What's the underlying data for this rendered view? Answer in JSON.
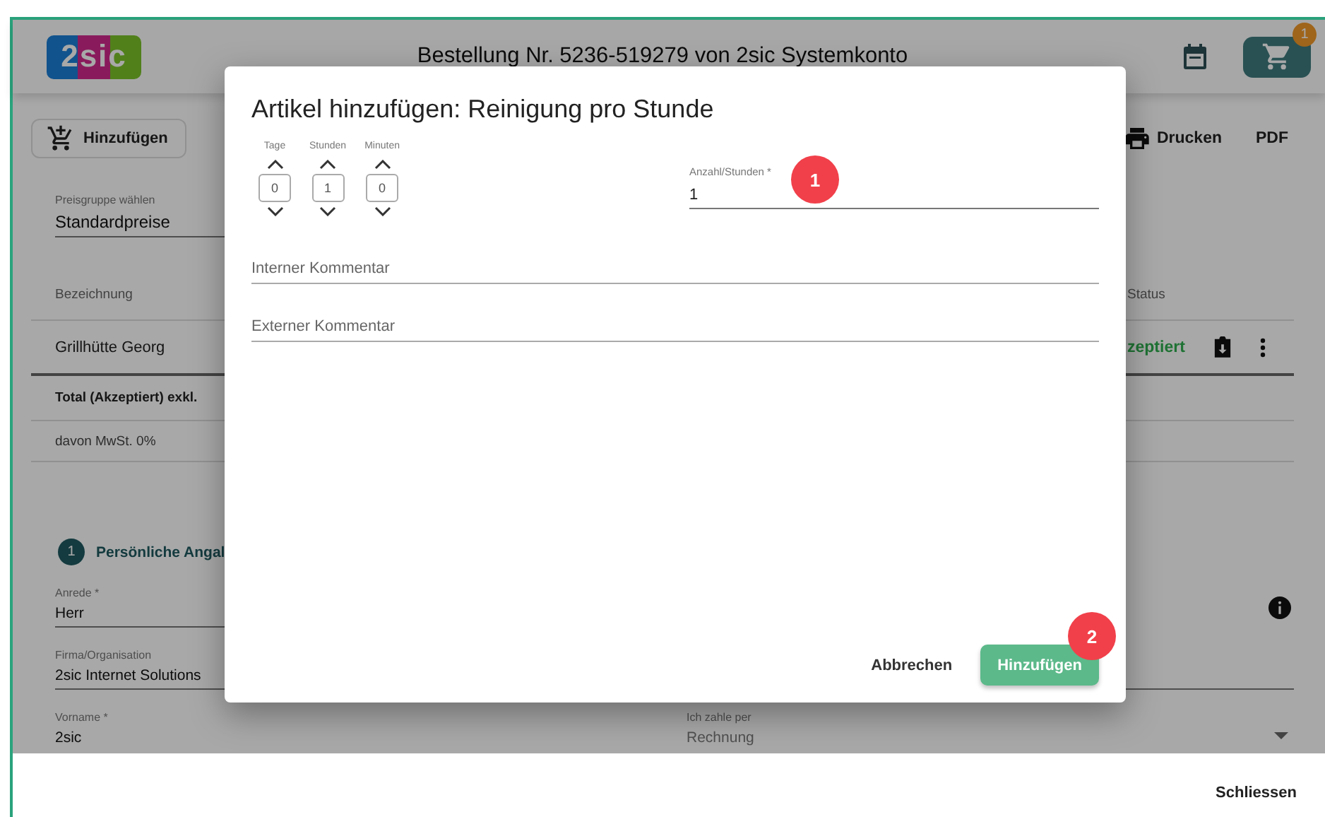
{
  "header": {
    "logo": "2sic",
    "title": "Bestellung Nr. 5236-519279 von 2sic Systemkonto",
    "cart_badge": "1"
  },
  "toolbar": {
    "add_button": "Hinzufügen",
    "print_button": "Drucken",
    "pdf_button": "PDF"
  },
  "price_group": {
    "label": "Preisgruppe wählen",
    "value": "Standardpreise"
  },
  "table": {
    "columns": [
      "Bezeichnung",
      "Status"
    ],
    "rows": [
      {
        "name": "Grillhütte Georg",
        "status": "zeptiert"
      }
    ],
    "total": "Total (Akzeptiert) exkl.",
    "vat": "davon MwSt. 0%"
  },
  "section": {
    "step": "1",
    "title": "Persönliche Angal"
  },
  "form": {
    "fields": [
      {
        "label": "Anrede *",
        "value": "Herr"
      },
      {
        "label": "Firma/Organisation",
        "value": "2sic Internet Solutions"
      },
      {
        "label": "Vorname *",
        "value": "2sic"
      }
    ],
    "payment": {
      "label": "Ich zahle per",
      "value": "Rechnung"
    }
  },
  "dialog": {
    "title": "Artikel hinzufügen: Reinigung pro Stunde",
    "duration": [
      {
        "label": "Tage",
        "value": "0"
      },
      {
        "label": "Stunden",
        "value": "1"
      },
      {
        "label": "Minuten",
        "value": "0"
      }
    ],
    "quantity": {
      "label": "Anzahl/Stunden *",
      "value": "1"
    },
    "comments": [
      {
        "placeholder": "Interner Kommentar"
      },
      {
        "placeholder": "Externer Kommentar"
      }
    ],
    "cancel_button": "Abbrechen",
    "add_button": "Hinzufügen",
    "callouts": [
      {
        "number": "1"
      },
      {
        "number": "2"
      }
    ]
  },
  "footer": {
    "close_button": "Schliessen"
  }
}
